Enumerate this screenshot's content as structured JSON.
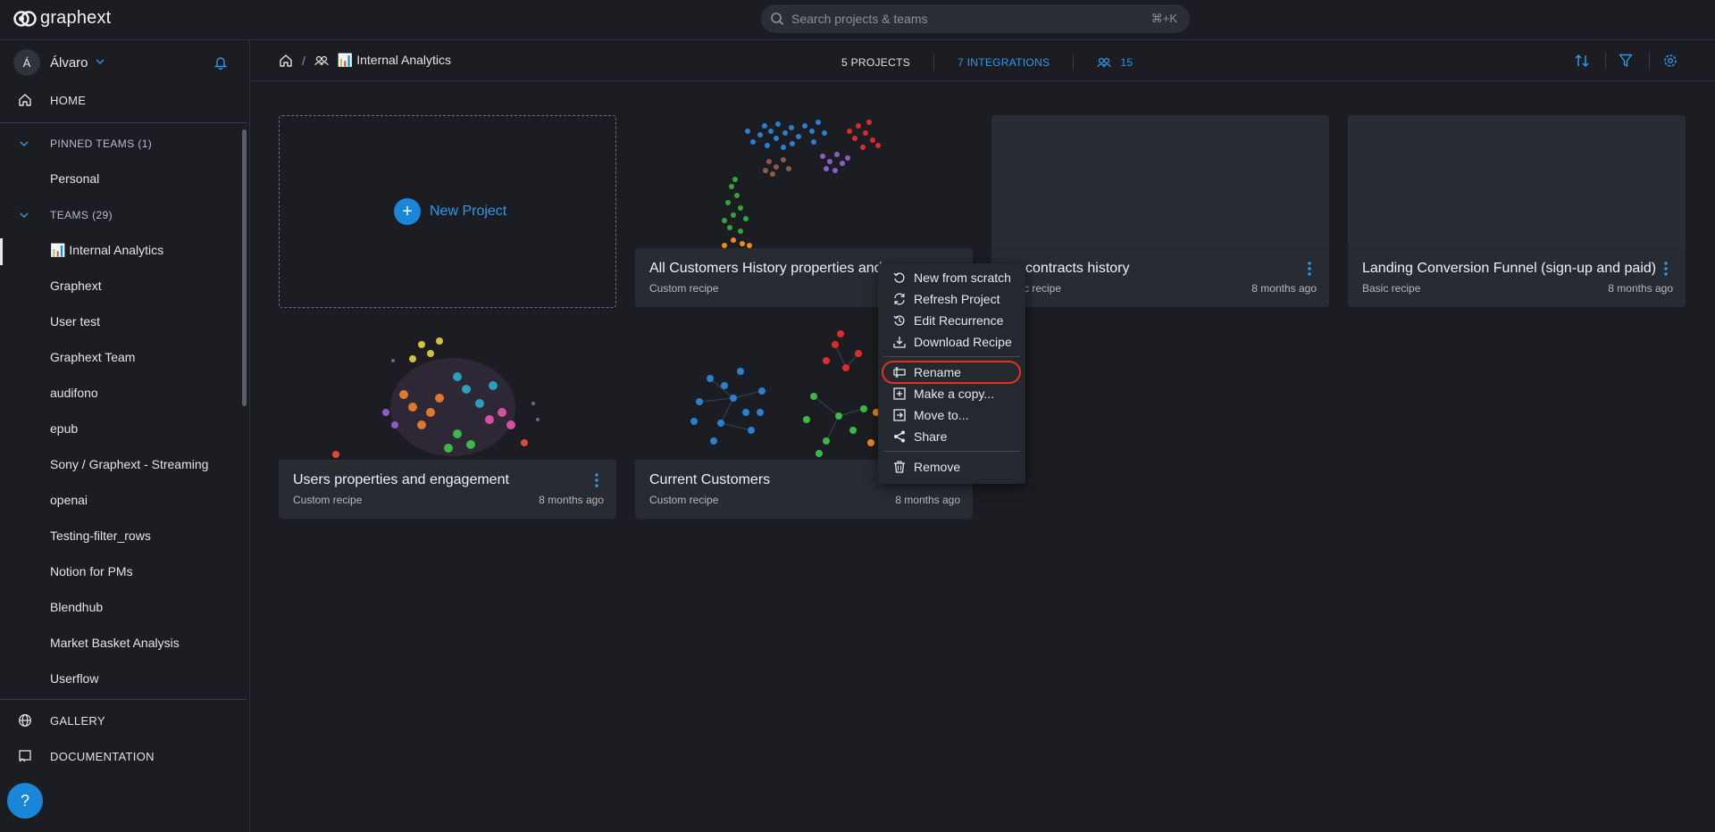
{
  "app": {
    "brand": "graphext"
  },
  "search": {
    "placeholder": "Search projects & teams",
    "shortcut": "⌘+K"
  },
  "user": {
    "initial": "Á",
    "name": "Álvaro"
  },
  "sidebar": {
    "home_label": "HOME",
    "pinned_label": "PINNED TEAMS (1)",
    "pinned_items": [
      "Personal"
    ],
    "teams_label": "TEAMS (29)",
    "team_items": [
      "📊 Internal Analytics",
      "Graphext",
      "User test",
      "Graphext Team",
      "audifono",
      "epub",
      "Sony / Graphext - Streaming",
      "openai",
      "Testing-filter_rows",
      "Notion for PMs",
      "Blendhub",
      "Market Basket Analysis",
      "Userflow"
    ],
    "gallery_label": "GALLERY",
    "documentation_label": "DOCUMENTATION",
    "help_label": "?"
  },
  "header": {
    "breadcrumb_team": "📊 Internal Analytics",
    "projects_count": "5 PROJECTS",
    "integrations_count": "7 INTEGRATIONS",
    "members_count": "15"
  },
  "new_project": {
    "label": "New Project"
  },
  "projects": [
    {
      "title": "All Customers History properties and",
      "subtitle": "Custom recipe",
      "time": ""
    },
    {
      "title": "contracts history",
      "subtitle": "c recipe",
      "time": "8 months ago"
    },
    {
      "title": "Landing Conversion Funnel (sign-up and paid)",
      "subtitle": "Basic recipe",
      "time": "8 months ago"
    },
    {
      "title": "Users properties and engagement",
      "subtitle": "Custom recipe",
      "time": "8 months ago"
    },
    {
      "title": "Current Customers",
      "subtitle": "Custom recipe",
      "time": "8 months ago"
    }
  ],
  "context_menu": {
    "items": [
      "New from scratch",
      "Refresh Project",
      "Edit Recurrence",
      "Download Recipe",
      "Rename",
      "Make a copy...",
      "Move to...",
      "Share",
      "Remove"
    ],
    "highlighted": "Rename"
  },
  "colors": {
    "accent": "#2e97e8",
    "highlight": "#e0321e",
    "background": "#1c1d22",
    "card": "#292b33"
  }
}
